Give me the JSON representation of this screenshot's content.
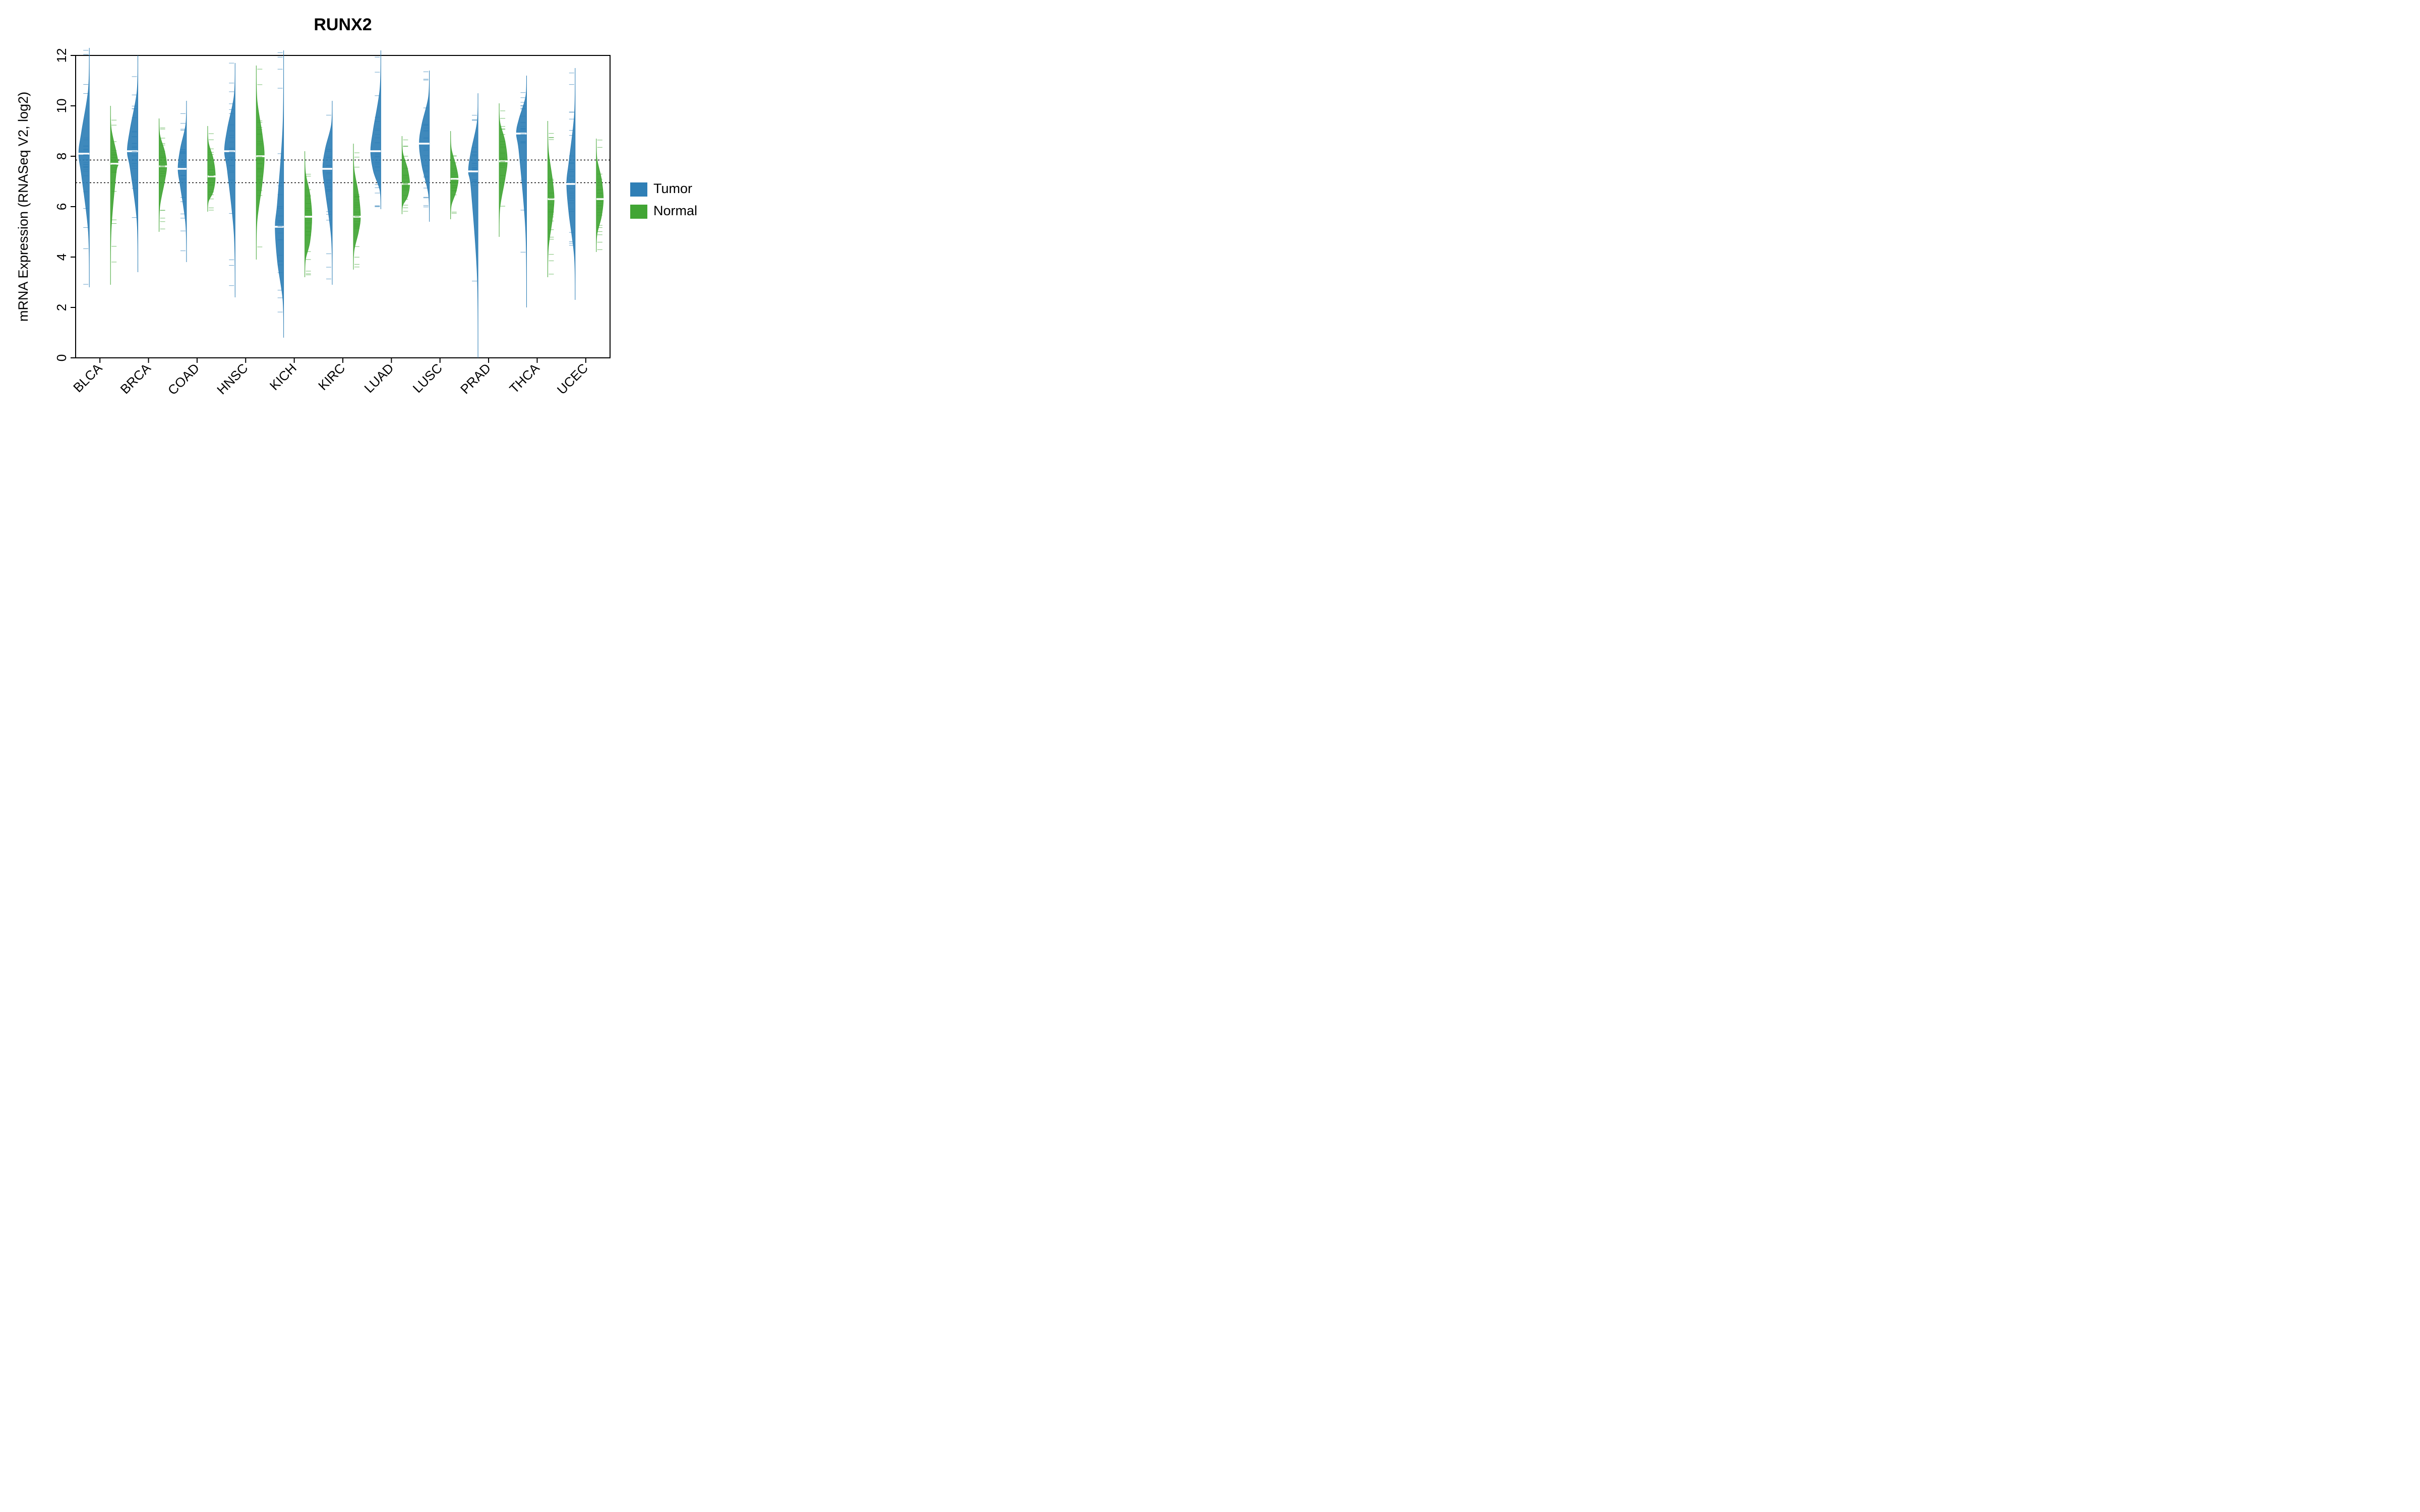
{
  "chart_data": {
    "type": "beanplot",
    "title": "RUNX2",
    "ylabel": "mRNA Expression (RNASeq V2, log2)",
    "xlabel": "",
    "ylim": [
      0,
      12
    ],
    "yticks": [
      0,
      2,
      4,
      6,
      8,
      10,
      12
    ],
    "reference_lines": [
      7.85,
      6.95
    ],
    "categories": [
      "BLCA",
      "BRCA",
      "COAD",
      "HNSC",
      "KICH",
      "KIRC",
      "LUAD",
      "LUSC",
      "PRAD",
      "THCA",
      "UCEC"
    ],
    "legend": [
      {
        "name": "Tumor",
        "color": "#2f7fb6"
      },
      {
        "name": "Normal",
        "color": "#41a534"
      }
    ],
    "colors": {
      "tumor": "#2f7fb6",
      "normal": "#41a534"
    },
    "series": [
      {
        "cancer": "BLCA",
        "tumor": {
          "median": 8.1,
          "q1": 7.2,
          "q3": 9.0,
          "min": 2.8,
          "max": 12.3,
          "mode_width": 1.0
        },
        "normal": {
          "median": 7.7,
          "q1": 7.3,
          "q3": 8.2,
          "min": 2.9,
          "max": 10.0,
          "mode_width": 0.72
        }
      },
      {
        "cancer": "BRCA",
        "tumor": {
          "median": 8.2,
          "q1": 7.5,
          "q3": 9.1,
          "min": 3.4,
          "max": 12.0,
          "mode_width": 1.0
        },
        "normal": {
          "median": 7.6,
          "q1": 7.0,
          "q3": 8.2,
          "min": 5.0,
          "max": 9.5,
          "mode_width": 0.72
        }
      },
      {
        "cancer": "COAD",
        "tumor": {
          "median": 7.5,
          "q1": 6.8,
          "q3": 8.3,
          "min": 3.8,
          "max": 10.2,
          "mode_width": 0.8
        },
        "normal": {
          "median": 7.2,
          "q1": 6.6,
          "q3": 7.9,
          "min": 5.8,
          "max": 9.2,
          "mode_width": 0.72
        }
      },
      {
        "cancer": "HNSC",
        "tumor": {
          "median": 8.2,
          "q1": 7.4,
          "q3": 9.1,
          "min": 2.4,
          "max": 11.7,
          "mode_width": 1.0
        },
        "normal": {
          "median": 8.0,
          "q1": 6.9,
          "q3": 8.9,
          "min": 3.9,
          "max": 11.6,
          "mode_width": 0.76
        }
      },
      {
        "cancer": "KICH",
        "tumor": {
          "median": 5.2,
          "q1": 3.8,
          "q3": 6.2,
          "min": 0.8,
          "max": 12.2,
          "mode_width": 0.8
        },
        "normal": {
          "median": 5.6,
          "q1": 4.6,
          "q3": 6.5,
          "min": 3.2,
          "max": 8.2,
          "mode_width": 0.66
        }
      },
      {
        "cancer": "KIRC",
        "tumor": {
          "median": 7.5,
          "q1": 6.6,
          "q3": 8.3,
          "min": 2.9,
          "max": 10.2,
          "mode_width": 0.9
        },
        "normal": {
          "median": 5.6,
          "q1": 5.0,
          "q3": 6.5,
          "min": 3.5,
          "max": 8.5,
          "mode_width": 0.66
        }
      },
      {
        "cancer": "LUAD",
        "tumor": {
          "median": 8.2,
          "q1": 7.4,
          "q3": 9.1,
          "min": 5.9,
          "max": 12.2,
          "mode_width": 0.96
        },
        "normal": {
          "median": 6.9,
          "q1": 6.4,
          "q3": 7.5,
          "min": 5.7,
          "max": 8.8,
          "mode_width": 0.72
        }
      },
      {
        "cancer": "LUSC",
        "tumor": {
          "median": 8.5,
          "q1": 7.6,
          "q3": 9.3,
          "min": 5.4,
          "max": 11.4,
          "mode_width": 0.96
        },
        "normal": {
          "median": 7.1,
          "q1": 6.6,
          "q3": 7.6,
          "min": 5.5,
          "max": 9.0,
          "mode_width": 0.72
        }
      },
      {
        "cancer": "PRAD",
        "tumor": {
          "median": 7.4,
          "q1": 6.7,
          "q3": 8.2,
          "min": 0.0,
          "max": 10.5,
          "mode_width": 0.9
        },
        "normal": {
          "median": 7.8,
          "q1": 7.1,
          "q3": 8.6,
          "min": 4.8,
          "max": 10.1,
          "mode_width": 0.76
        }
      },
      {
        "cancer": "THCA",
        "tumor": {
          "median": 8.9,
          "q1": 8.1,
          "q3": 9.5,
          "min": 2.0,
          "max": 11.2,
          "mode_width": 0.96
        },
        "normal": {
          "median": 6.3,
          "q1": 5.5,
          "q3": 7.1,
          "min": 3.2,
          "max": 9.4,
          "mode_width": 0.6
        }
      },
      {
        "cancer": "UCEC",
        "tumor": {
          "median": 6.9,
          "q1": 5.7,
          "q3": 7.8,
          "min": 2.3,
          "max": 11.5,
          "mode_width": 0.8
        },
        "normal": {
          "median": 6.3,
          "q1": 5.6,
          "q3": 7.1,
          "min": 4.2,
          "max": 8.7,
          "mode_width": 0.66
        }
      }
    ]
  }
}
